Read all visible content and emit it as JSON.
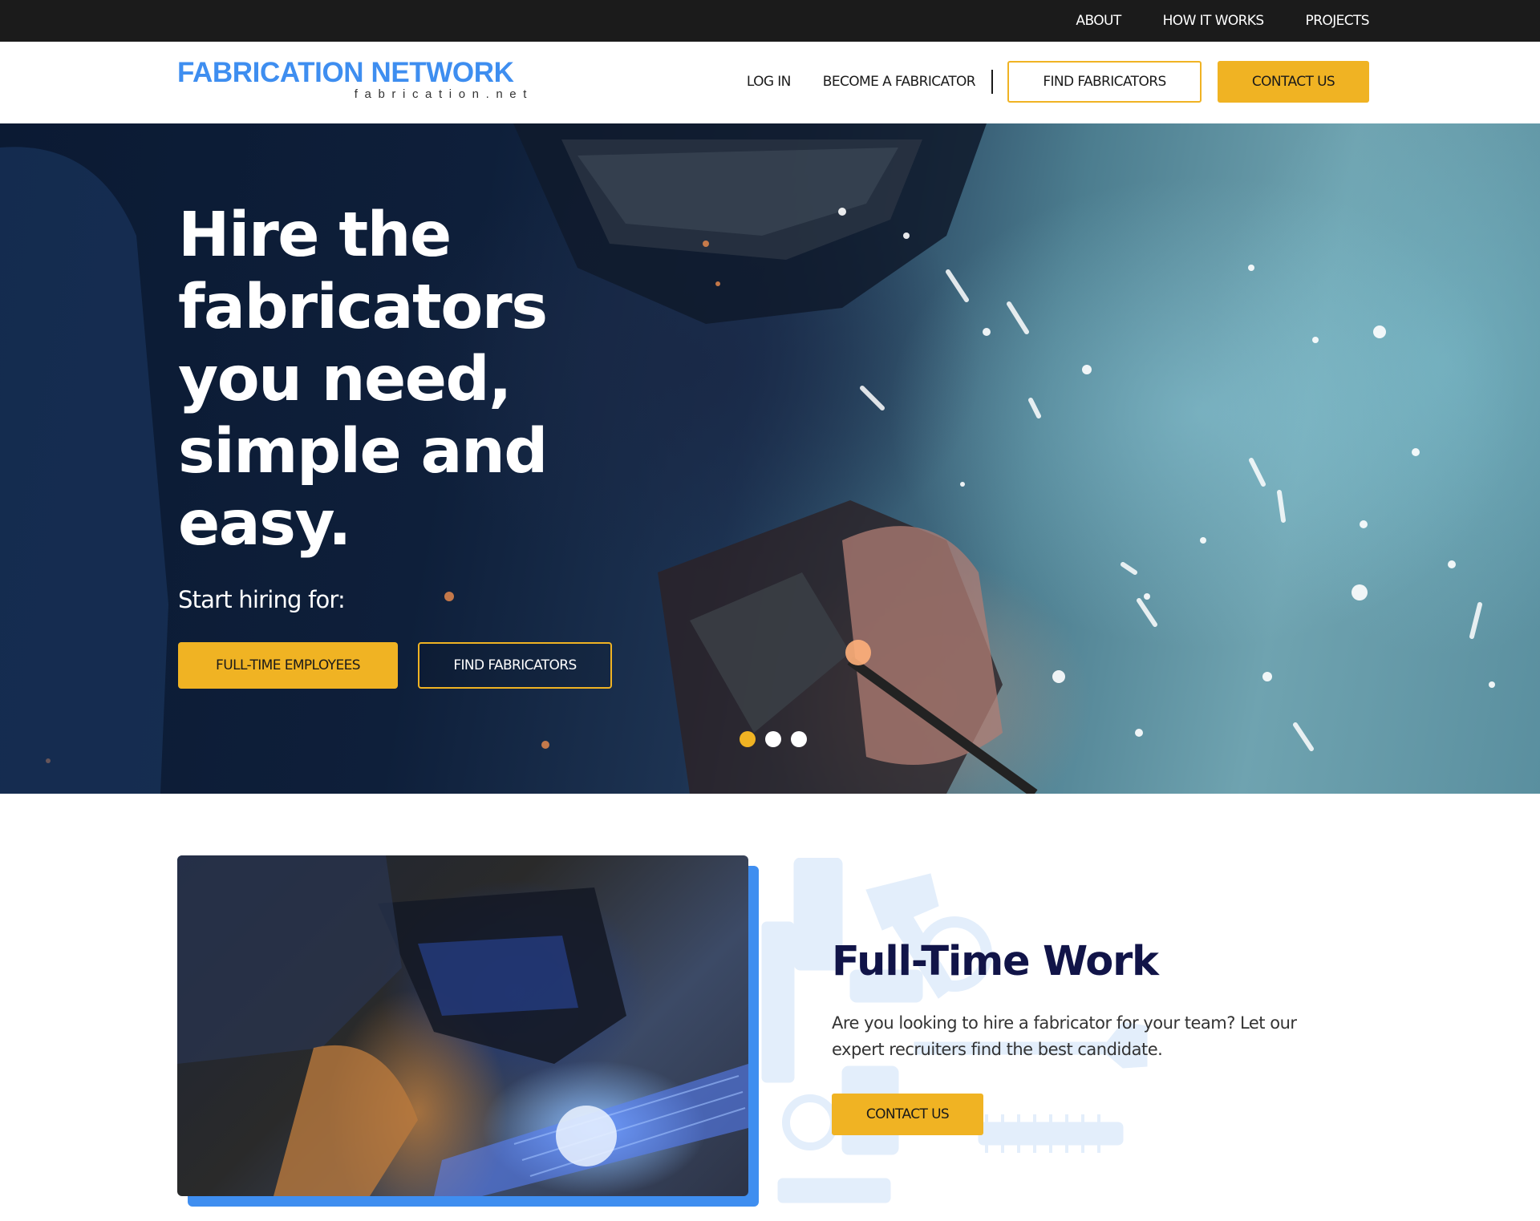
{
  "topbar": {
    "links": [
      "ABOUT",
      "HOW IT WORKS",
      "PROJECTS"
    ]
  },
  "header": {
    "logo_title": "FABRICATION NETWORK",
    "logo_subtitle": "fabrication.net",
    "login_label": "LOG IN",
    "become_label": "BECOME A FABRICATOR",
    "find_label": "FIND FABRICATORS",
    "contact_label": "CONTACT US"
  },
  "hero": {
    "title": "Hire the fabricators you need, simple and easy.",
    "subtitle": "Start hiring for:",
    "primary_button": "FULL-TIME EMPLOYEES",
    "secondary_button": "FIND FABRICATORS",
    "slides_count": 3,
    "active_slide": 1
  },
  "feature": {
    "title": "Full-Time Work",
    "text": "Are you looking to hire a fabricator for your team? Let our expert recruiters find the best candidate.",
    "button": "CONTACT US"
  },
  "colors": {
    "accent": "#f0b323",
    "brand_blue": "#3e8ef0",
    "heading_navy": "#111448",
    "topbar_bg": "#1b1b1b"
  },
  "icons": [
    "tools-illustration",
    "welder-hero-image",
    "welder-feature-image"
  ]
}
